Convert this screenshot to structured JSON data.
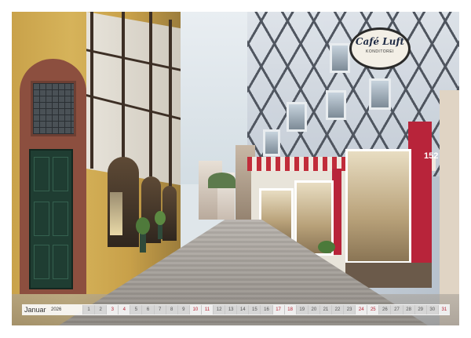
{
  "calendar": {
    "month": "Januar",
    "year": "2026",
    "days": [
      {
        "n": "1",
        "weekend": false
      },
      {
        "n": "2",
        "weekend": false
      },
      {
        "n": "3",
        "weekend": true
      },
      {
        "n": "4",
        "weekend": true
      },
      {
        "n": "5",
        "weekend": false
      },
      {
        "n": "6",
        "weekend": false
      },
      {
        "n": "7",
        "weekend": false
      },
      {
        "n": "8",
        "weekend": false
      },
      {
        "n": "9",
        "weekend": false
      },
      {
        "n": "10",
        "weekend": true
      },
      {
        "n": "11",
        "weekend": true
      },
      {
        "n": "12",
        "weekend": false
      },
      {
        "n": "13",
        "weekend": false
      },
      {
        "n": "14",
        "weekend": false
      },
      {
        "n": "15",
        "weekend": false
      },
      {
        "n": "16",
        "weekend": false
      },
      {
        "n": "17",
        "weekend": true
      },
      {
        "n": "18",
        "weekend": true
      },
      {
        "n": "19",
        "weekend": false
      },
      {
        "n": "20",
        "weekend": false
      },
      {
        "n": "21",
        "weekend": false
      },
      {
        "n": "22",
        "weekend": false
      },
      {
        "n": "23",
        "weekend": false
      },
      {
        "n": "24",
        "weekend": true
      },
      {
        "n": "25",
        "weekend": true
      },
      {
        "n": "26",
        "weekend": false
      },
      {
        "n": "27",
        "weekend": false
      },
      {
        "n": "28",
        "weekend": false
      },
      {
        "n": "29",
        "weekend": false
      },
      {
        "n": "30",
        "weekend": false
      },
      {
        "n": "31",
        "weekend": true
      }
    ]
  },
  "sign": {
    "title": "Café Luft",
    "subtitle": "KONDITOREI"
  },
  "house_number": "152",
  "colors": {
    "weekend_text": "#b51f2f",
    "shop_red": "#b8243a",
    "facade_yellow": "#d6b35a",
    "door_green": "#1f3d32"
  }
}
